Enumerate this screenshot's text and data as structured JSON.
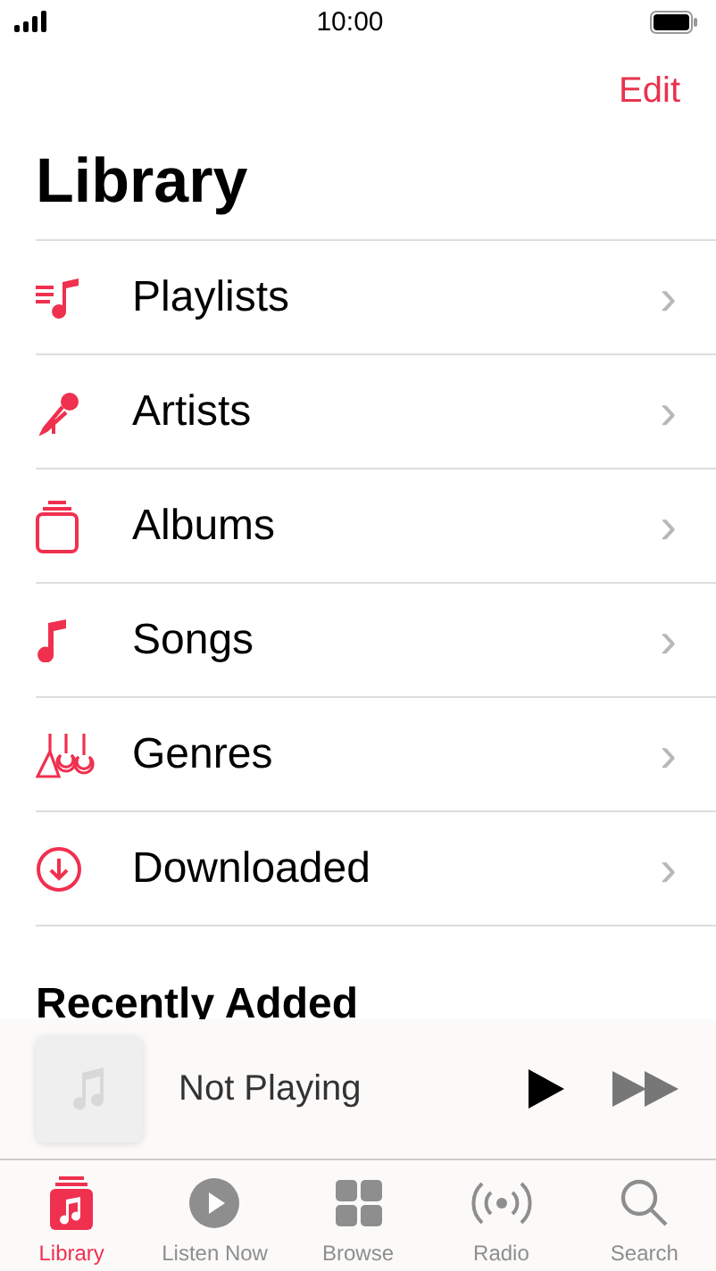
{
  "status_bar": {
    "time": "10:00"
  },
  "nav": {
    "edit": "Edit"
  },
  "title": "Library",
  "items": [
    {
      "kind": "playlists",
      "label": "Playlists",
      "chevron": "›"
    },
    {
      "kind": "artists",
      "label": "Artists",
      "chevron": "›"
    },
    {
      "kind": "albums",
      "label": "Albums",
      "chevron": "›"
    },
    {
      "kind": "songs",
      "label": "Songs",
      "chevron": "›"
    },
    {
      "kind": "genres",
      "label": "Genres",
      "chevron": "›"
    },
    {
      "kind": "downloaded",
      "label": "Downloaded",
      "chevron": "›"
    }
  ],
  "section_title": "Recently Added",
  "mini_player": {
    "title": "Not Playing"
  },
  "tabs": [
    {
      "kind": "library",
      "label": "Library",
      "selected": true
    },
    {
      "kind": "listen",
      "label": "Listen Now",
      "selected": false
    },
    {
      "kind": "browse",
      "label": "Browse",
      "selected": false
    },
    {
      "kind": "radio",
      "label": "Radio",
      "selected": false
    },
    {
      "kind": "search",
      "label": "Search",
      "selected": false
    }
  ]
}
